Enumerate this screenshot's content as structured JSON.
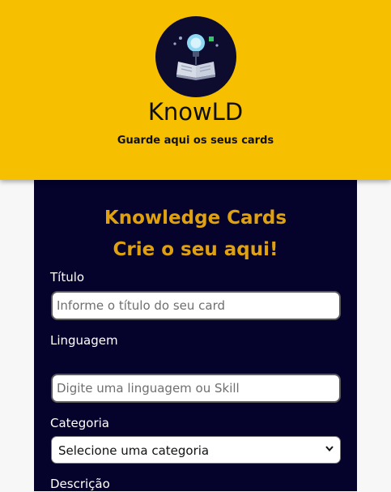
{
  "header": {
    "app_title": "KnowLD",
    "subtitle": "Guarde aqui os seus cards",
    "logo_icon": "lightbulb-book-icon",
    "background_color": "#f6bf00"
  },
  "form": {
    "title_line1": "Knowledge Cards",
    "title_line2": "Crie o seu aqui!",
    "title_color": "#e0a10f",
    "panel_color": "#05022b",
    "fields": {
      "titulo": {
        "label": "Título",
        "placeholder": "Informe o título do seu card",
        "value": ""
      },
      "linguagem": {
        "label": "Linguagem",
        "placeholder": "Digite uma linguagem ou Skill",
        "value": ""
      },
      "categoria": {
        "label": "Categoria",
        "selected": "Selecione uma categoria",
        "icon": "chevron-down-icon"
      },
      "descricao": {
        "label": "Descrição"
      }
    }
  }
}
